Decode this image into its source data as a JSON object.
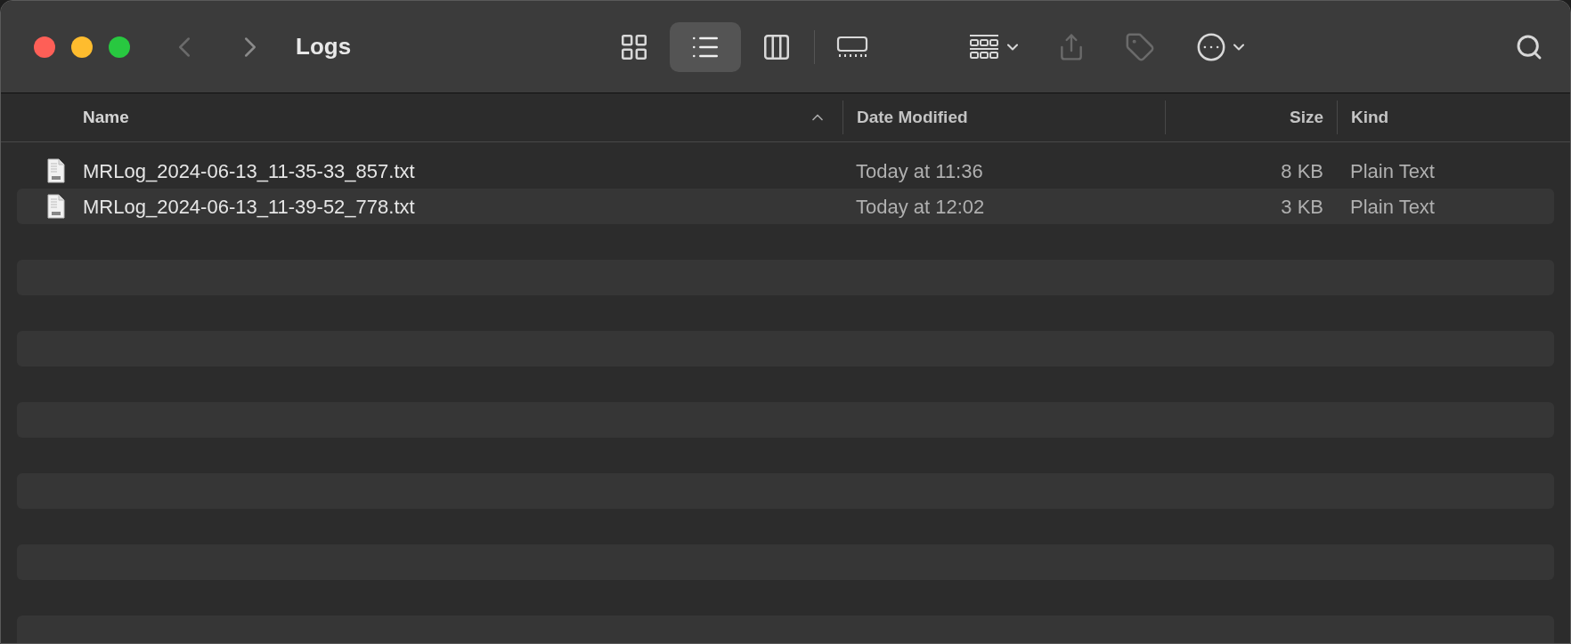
{
  "window": {
    "title": "Logs"
  },
  "navigation": [
    {
      "kind": "back",
      "disabled": true
    },
    {
      "kind": "forward",
      "disabled": false
    }
  ],
  "views": [
    {
      "kind": "icons",
      "selected": false
    },
    {
      "kind": "list",
      "selected": true
    },
    {
      "kind": "columns",
      "selected": false
    },
    {
      "kind": "gallery",
      "selected": false
    }
  ],
  "toolbar": [
    {
      "kind": "group",
      "disabled": false
    },
    {
      "kind": "share",
      "disabled": true
    },
    {
      "kind": "tag",
      "disabled": true
    },
    {
      "kind": "more",
      "disabled": false
    },
    {
      "kind": "search",
      "disabled": false
    }
  ],
  "table": {
    "columns": [
      {
        "label": "Name",
        "sorted": true
      },
      {
        "label": "Date Modified",
        "sorted": false
      },
      {
        "label": "Size",
        "sorted": false
      },
      {
        "label": "Kind",
        "sorted": false
      }
    ],
    "rows": [
      {
        "name": "MRLog_2024-06-13_11-35-33_857.txt",
        "date": "Today at 11:36",
        "size": "8 KB",
        "kind": "Plain Text"
      },
      {
        "name": "MRLog_2024-06-13_11-39-52_778.txt",
        "date": "Today at 12:02",
        "size": "3 KB",
        "kind": "Plain Text"
      }
    ]
  }
}
